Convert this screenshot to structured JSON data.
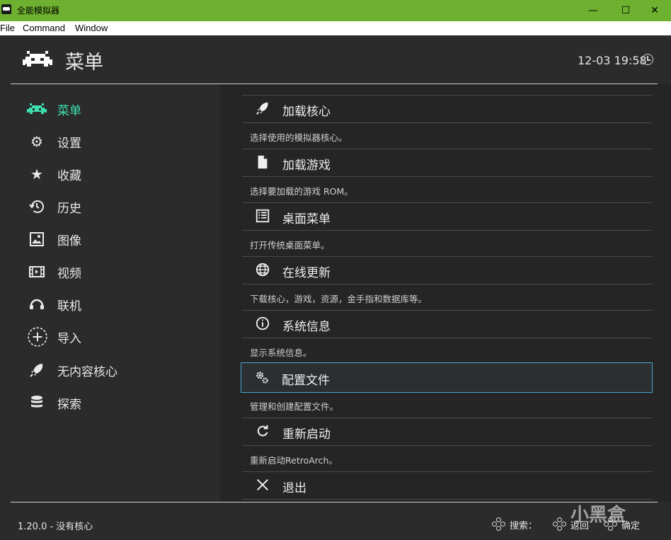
{
  "window": {
    "title": "全能模拟器",
    "minimize": "—",
    "maximize": "☐",
    "close": "✕"
  },
  "menubar": {
    "file": "File",
    "command": "Command",
    "window": "Window"
  },
  "header": {
    "title": "菜单",
    "clock": "12-03 19:58"
  },
  "sidebar": {
    "items": [
      {
        "label": "菜单",
        "icon": "invader-icon",
        "active": true
      },
      {
        "label": "设置",
        "icon": "gear-icon"
      },
      {
        "label": "收藏",
        "icon": "star-icon"
      },
      {
        "label": "历史",
        "icon": "history-icon"
      },
      {
        "label": "图像",
        "icon": "image-icon"
      },
      {
        "label": "视频",
        "icon": "film-icon"
      },
      {
        "label": "联机",
        "icon": "headset-icon"
      },
      {
        "label": "导入",
        "icon": "plus-icon"
      },
      {
        "label": "无内容核心",
        "icon": "rocket-icon"
      },
      {
        "label": "探索",
        "icon": "database-icon"
      }
    ]
  },
  "main": {
    "items": [
      {
        "label": "加载核心",
        "desc": "选择使用的模拟器核心。",
        "icon": "rocket-icon"
      },
      {
        "label": "加载游戏",
        "desc": "选择要加载的游戏 ROM。",
        "icon": "file-icon"
      },
      {
        "label": "桌面菜单",
        "desc": "打开传统桌面菜单。",
        "icon": "list-icon"
      },
      {
        "label": "在线更新",
        "desc": "下载核心，游戏，资源，金手指和数据库等。",
        "icon": "globe-icon"
      },
      {
        "label": "系统信息",
        "desc": "显示系统信息。",
        "icon": "info-icon"
      },
      {
        "label": "配置文件",
        "desc": "管理和创建配置文件。",
        "icon": "gears-icon",
        "selected": true
      },
      {
        "label": "重新启动",
        "desc": "重新启动RetroArch。",
        "icon": "restart-icon"
      },
      {
        "label": "退出",
        "icon": "close-icon"
      }
    ]
  },
  "footer": {
    "version": "1.20.0 - 没有核心",
    "search": "搜索：",
    "back": "返回",
    "confirm": "确定",
    "watermark": "小黑盒"
  }
}
